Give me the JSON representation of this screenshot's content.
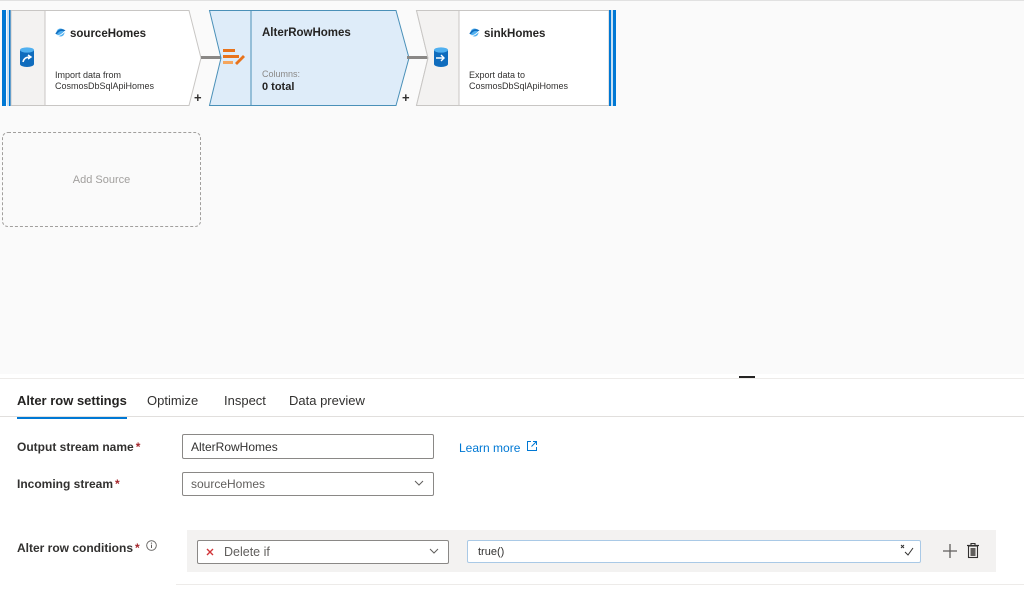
{
  "canvas": {
    "nodes": [
      {
        "id": "source",
        "title": "sourceHomes",
        "description_line1": "Import data from",
        "description_line2": "CosmosDbSqlApiHomes",
        "icon": "database-source-icon"
      },
      {
        "id": "alterrow",
        "title": "AlterRowHomes",
        "columns_label": "Columns:",
        "columns_value": "0 total",
        "icon": "alter-row-icon",
        "selected": true
      },
      {
        "id": "sink",
        "title": "sinkHomes",
        "description_line1": "Export data to",
        "description_line2": "CosmosDbSqlApiHomes",
        "icon": "database-sink-icon"
      }
    ],
    "add_node_symbol": "+",
    "add_source_label": "Add Source"
  },
  "panel": {
    "tabs": [
      {
        "label": "Alter row settings",
        "active": true
      },
      {
        "label": "Optimize",
        "active": false
      },
      {
        "label": "Inspect",
        "active": false
      },
      {
        "label": "Data preview",
        "active": false
      }
    ],
    "output_stream": {
      "label": "Output stream name",
      "required_mark": "*",
      "value": "AlterRowHomes"
    },
    "learn_more": "Learn more",
    "incoming_stream": {
      "label": "Incoming stream",
      "required_mark": "*",
      "value": "sourceHomes"
    },
    "conditions": {
      "label": "Alter row conditions",
      "required_mark": "*",
      "rows": [
        {
          "type": "Delete if",
          "expression": "true()"
        }
      ]
    }
  },
  "colors": {
    "accent": "#0078d4",
    "selected_node_fill": "#deecf9",
    "alter_row_icon": "#e8731b",
    "required": "#a4262c",
    "remove_x": "#d13438"
  }
}
